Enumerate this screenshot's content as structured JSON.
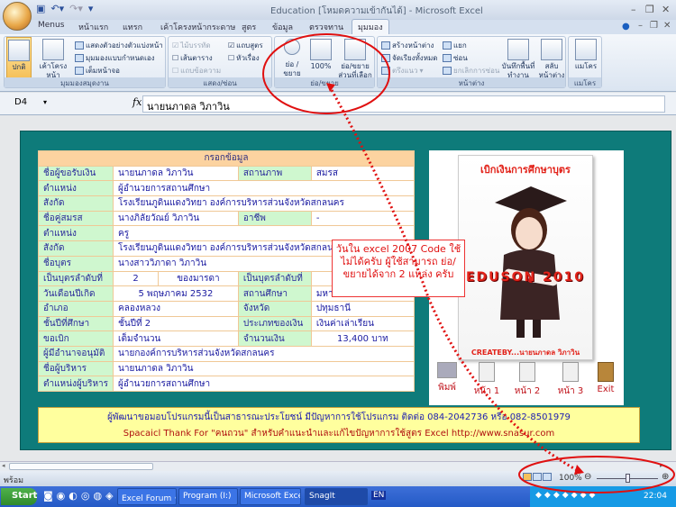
{
  "window": {
    "title": "Education  [โหมดความเข้ากันได้]  - Microsoft Excel"
  },
  "tabs": [
    "Menus",
    "หน้าแรก",
    "แทรก",
    "เค้าโครงหน้ากระดาษ",
    "สูตร",
    "ข้อมูล",
    "ตรวจทาน",
    "มุมมอง"
  ],
  "ribbon": {
    "workbook_views": {
      "label": "มุมมองสมุดงาน",
      "normal": "ปกติ",
      "page_layout": "เค้าโครง หน้ากระดาษ",
      "page_break": "แสดงตัวอย่างตัวแบ่งหน้า",
      "custom_views": "มุมมองแบบกำหนดเอง",
      "full_screen": "เต็มหน้าจอ"
    },
    "show_hide": {
      "label": "แสดง/ซ่อน",
      "ruler": "ไม้บรรทัด",
      "formula_bar": "แถบสูตร",
      "gridlines": "เส้นตาราง",
      "headings": "หัวเรื่อง",
      "message_bar": "แถบข้อความ"
    },
    "zoom": {
      "label": "ย่อ/ขยาย",
      "zoom": "ย่อ /ขยาย",
      "hundred": "100%",
      "zoom_selection": "ย่อ/ขยาย ส่วนที่เลือก"
    },
    "window": {
      "label": "หน้าต่าง",
      "new_window": "สร้างหน้าต่าง",
      "arrange_all": "จัดเรียงทั้งหมด",
      "freeze": "ตรึงแนว",
      "split": "แยก",
      "hide": "ซ่อน",
      "unhide": "ยกเลิกการซ่อน",
      "save_workspace": "บันทึกพื้นที่ทำงาน",
      "switch_windows": "สลับ หน้าต่าง"
    },
    "macros": {
      "label": "แมโคร",
      "macros": "แมโคร"
    }
  },
  "formula_bar": {
    "name_box": "D4",
    "fx": "fx",
    "value": "นายนภาดล  วิภาวิน"
  },
  "form": {
    "header": "กรอกข้อมูล",
    "rows": [
      [
        "ชื่อผู้ขอรับเงิน",
        "นายนภาดล  วิภาวิน",
        "สถานภาพ",
        "สมรส"
      ],
      [
        "ตำแหน่ง",
        "ผู้อำนวยการสถานศึกษา"
      ],
      [
        "สังกัด",
        "โรงเรียนภูดินแดงวิทยา  องค์การบริหารส่วนจังหวัดสกลนคร"
      ],
      [
        "ชื่อคู่สมรส",
        "นางภิลัยวัณย์  วิภาวิน",
        "อาชีพ",
        "-"
      ],
      [
        "ตำแหน่ง",
        "ครู"
      ],
      [
        "สังกัด",
        "โรงเรียนภูดินแดงวิทยา องค์การบริหารส่วนจังหวัดสกลนคร"
      ],
      [
        "ชื่อบุตร",
        "นางสาววิภาดา  วิภาวิน"
      ],
      [
        "เป็นบุตรลำดับที่",
        "2",
        "ของมารดา",
        "เป็นบุตรลำดับที่",
        "2"
      ],
      [
        "วันเดือนปีเกิด",
        "5 พฤษภาคม 2532",
        "สถานศึกษา",
        "มหาวิ"
      ],
      [
        "อำเภอ",
        "คลองหลวง",
        "จังหวัด",
        "ปทุมธานี"
      ],
      [
        "ชั้นปีที่ศึกษา",
        "ชั้นปีที่ 2",
        "ประเภทของเงิน",
        "เงินค่าเล่าเรียน"
      ],
      [
        "ขอเบิก",
        "เต็มจำนวน",
        "จำนวนเงิน",
        "13,400    บาท"
      ],
      [
        "ผู้มีอำนาจอนุมัติ",
        "นายกองค์การบริหารส่วนจังหวัดสกลนคร"
      ],
      [
        "ชื่อผู้บริหาร",
        "นายนภาดล  วิภาวิน"
      ],
      [
        "ตำแหน่งผู้บริหาร",
        "ผู้อำนวยการสถานศึกษา"
      ]
    ]
  },
  "poster": {
    "title": "เบิกเงินการศึกษาบุตร",
    "brand": "EDUSON 2010",
    "credit": "CREATEBY...นายนภาดล  วิภาวิน"
  },
  "nav_buttons": [
    "พิมพ์",
    "หน้า 1",
    "หน้า 2",
    "หน้า 3",
    "Exit"
  ],
  "banner": {
    "line1": "ผู้พัฒนาขอมอบโปรแกรมนี้เป็นสาธารณะประโยชน์ มีปัญหาการใช้โปรแกรม ติดต่อ 084-2042736 หรือ 082-8501979",
    "line2": "Spacaicl Thank For \"คนถวน\"  สำหรับคำแนะนำและแก้ไขปัญหาการใช้สูตร Excel http://www.snasur.com"
  },
  "callout": "วันใน excel 2007 Code ใช้ไม่ได้ครับ ผู้ใช้สามารถ ย่อ/ขยายได้จาก 2 แหล่ง ครับ",
  "status": {
    "ready": "พร้อม",
    "zoom": "100%"
  },
  "taskbar": {
    "start": "Start",
    "items": [
      "Excel Forum • แลก...",
      "Program (I:)",
      "Microsoft Excel - Ed...",
      "SnagIt"
    ],
    "lang": "EN",
    "clock": "22:04"
  },
  "colors": {
    "teal": "#0e7b7a",
    "label_bg": "#cff7cf",
    "header_bg": "#fcd3a0",
    "banner_bg": "#ffff9e",
    "annotation": "#e01010"
  }
}
